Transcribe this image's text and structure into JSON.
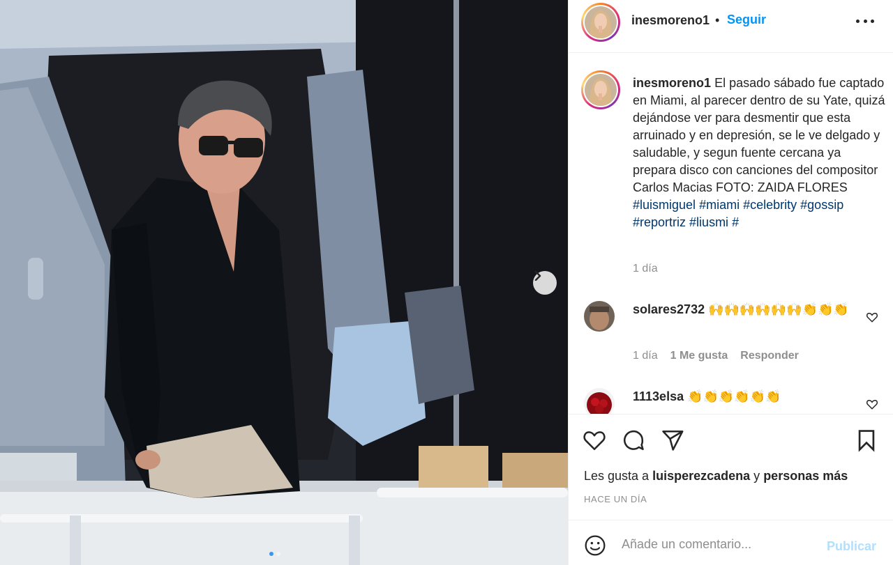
{
  "post": {
    "username": "inesmoreno1",
    "follow_label": "Seguir",
    "separator": "•",
    "caption": {
      "username": "inesmoreno1",
      "text": "El pasado sábado fue captado en Miami, al parecer dentro de su Yate, quizá dejándose ver para desmentir que esta arruinado y en depresión, se le ve delgado y saludable, y segun fuente cercana ya prepara disco con canciones del compositor Carlos Macias FOTO: ZAIDA FLORES",
      "hashtags": [
        "#luismiguel",
        "#miami",
        "#celebrity",
        "#gossip",
        "#reportriz",
        "#liusmi",
        "#"
      ],
      "time": "1 día"
    },
    "comments": [
      {
        "username": "solares2732",
        "text": "🙌🙌🙌🙌🙌🙌👏👏👏",
        "time": "1 día",
        "likes": "1 Me gusta",
        "reply": "Responder"
      },
      {
        "username": "1113elsa",
        "text": "👏👏👏👏👏👏"
      }
    ],
    "likes_prefix": "Les gusta a",
    "likes_user": "luisperezcadena",
    "likes_conj": "y",
    "likes_others": "personas más",
    "posted_ago": "HACE UN DÍA",
    "comment_placeholder": "Añade un comentario...",
    "publish_label": "Publicar",
    "carousel": {
      "slides": 2,
      "active": 1
    }
  },
  "icons": {
    "next": "chevron-right-icon",
    "more": "more-options-icon",
    "like": "heart-icon",
    "comment": "comment-bubble-icon",
    "share": "paper-plane-icon",
    "save": "bookmark-icon",
    "emoji": "smiley-icon"
  },
  "colors": {
    "accent": "#0095f6",
    "hashtag": "#00376b",
    "muted": "#8e8e8e",
    "publish_disabled": "#b2dffc"
  }
}
